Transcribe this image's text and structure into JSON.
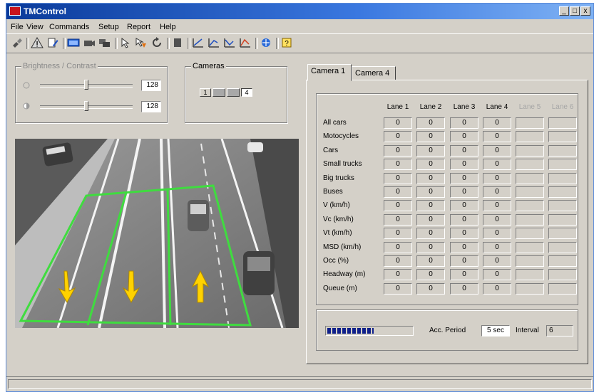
{
  "window": {
    "title": "TMControl",
    "minimize": "_",
    "maximize": "□",
    "close": "x"
  },
  "menu": [
    "File",
    "View",
    "Commands",
    "Setup",
    "Report",
    "Help"
  ],
  "toolbar": {
    "icons": [
      "connect-icon",
      "warning-icon",
      "edit-icon",
      "display-icon",
      "camera-icon",
      "cameras-icon",
      "cursor-icon",
      "pointer-icon",
      "refresh-icon",
      "stop-icon",
      "chart-1-icon",
      "chart-2-icon",
      "chart-3-icon",
      "chart-4-icon",
      "network-icon",
      "help-icon"
    ]
  },
  "brightness_contrast": {
    "label": "Brightness / Contrast",
    "brightness_value": "128",
    "contrast_value": "128",
    "brightness_level": 0.5,
    "contrast_level": 0.5
  },
  "cameras": {
    "label": "Cameras",
    "buttons": [
      "1",
      "",
      "",
      "4"
    ],
    "selected": 3
  },
  "tabs": [
    {
      "label": "Camera 1",
      "active": true
    },
    {
      "label": "Camera 4",
      "active": false
    }
  ],
  "stats": {
    "columns": [
      {
        "label": "Lane 1",
        "enabled": true
      },
      {
        "label": "Lane 2",
        "enabled": true
      },
      {
        "label": "Lane 3",
        "enabled": true
      },
      {
        "label": "Lane 4",
        "enabled": true
      },
      {
        "label": "Lane 5",
        "enabled": false
      },
      {
        "label": "Lane 6",
        "enabled": false
      }
    ],
    "rows": [
      {
        "label": "All cars",
        "values": [
          "0",
          "0",
          "0",
          "0"
        ]
      },
      {
        "label": "Motocycles",
        "values": [
          "0",
          "0",
          "0",
          "0"
        ]
      },
      {
        "label": "Cars",
        "values": [
          "0",
          "0",
          "0",
          "0"
        ]
      },
      {
        "label": "Small trucks",
        "values": [
          "0",
          "0",
          "0",
          "0"
        ]
      },
      {
        "label": "Big trucks",
        "values": [
          "0",
          "0",
          "0",
          "0"
        ]
      },
      {
        "label": "Buses",
        "values": [
          "0",
          "0",
          "0",
          "0"
        ]
      },
      {
        "label": "V (km/h)",
        "values": [
          "0",
          "0",
          "0",
          "0"
        ]
      },
      {
        "label": "Vc (km/h)",
        "values": [
          "0",
          "0",
          "0",
          "0"
        ]
      },
      {
        "label": "Vt (km/h)",
        "values": [
          "0",
          "0",
          "0",
          "0"
        ]
      },
      {
        "label": "MSD (km/h)",
        "values": [
          "0",
          "0",
          "0",
          "0"
        ]
      },
      {
        "label": "Occ (%)",
        "values": [
          "0",
          "0",
          "0",
          "0"
        ]
      },
      {
        "label": "Headway (m)",
        "values": [
          "0",
          "0",
          "0",
          "0"
        ]
      },
      {
        "label": "Queue (m)",
        "values": [
          "0",
          "0",
          "0",
          "0"
        ]
      }
    ]
  },
  "period": {
    "acc_label": "Acc. Period",
    "acc_value": "5 sec",
    "interval_label": "Interval",
    "interval_value": "6",
    "progress": 0.55
  },
  "status": {
    "text": ""
  },
  "colors": {
    "title_start": "#0a3a9a",
    "detection_zone": "#3fdc3f",
    "arrow": "#ffd200",
    "progress": "#10208a"
  }
}
